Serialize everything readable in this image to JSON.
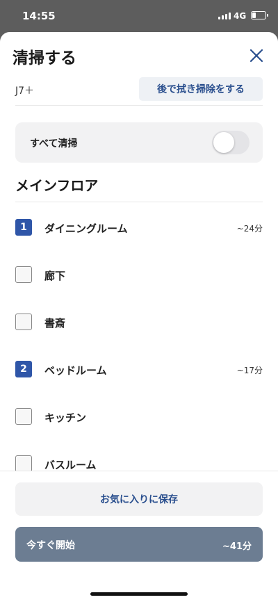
{
  "status_bar": {
    "time": "14:55",
    "network": "4G"
  },
  "sheet": {
    "title": "清掃する",
    "model": "J7＋",
    "later_button": "後で拭き掃除をする"
  },
  "clean_all": {
    "label": "すべて清掃",
    "enabled": false
  },
  "section": {
    "title": "メインフロア"
  },
  "rooms": [
    {
      "name": "ダイニングルーム",
      "order": "1",
      "checked": true,
      "time": "~24分"
    },
    {
      "name": "廊下",
      "order": "",
      "checked": false,
      "time": ""
    },
    {
      "name": "書斎",
      "order": "",
      "checked": false,
      "time": ""
    },
    {
      "name": "ベッドルーム",
      "order": "2",
      "checked": true,
      "time": "~17分"
    },
    {
      "name": "キッチン",
      "order": "",
      "checked": false,
      "time": ""
    },
    {
      "name": "バスルーム",
      "order": "",
      "checked": false,
      "time": ""
    }
  ],
  "footer": {
    "favorite_button": "お気に入りに保存",
    "start_button": "今すぐ開始",
    "start_time": "~41分"
  },
  "colors": {
    "accent": "#2f56a8",
    "link_text": "#2a4f8e",
    "start_button_bg": "#6c7d92",
    "backdrop": "#5d5d5d"
  },
  "icons": [
    "signal-icon",
    "battery-icon",
    "close-icon"
  ]
}
